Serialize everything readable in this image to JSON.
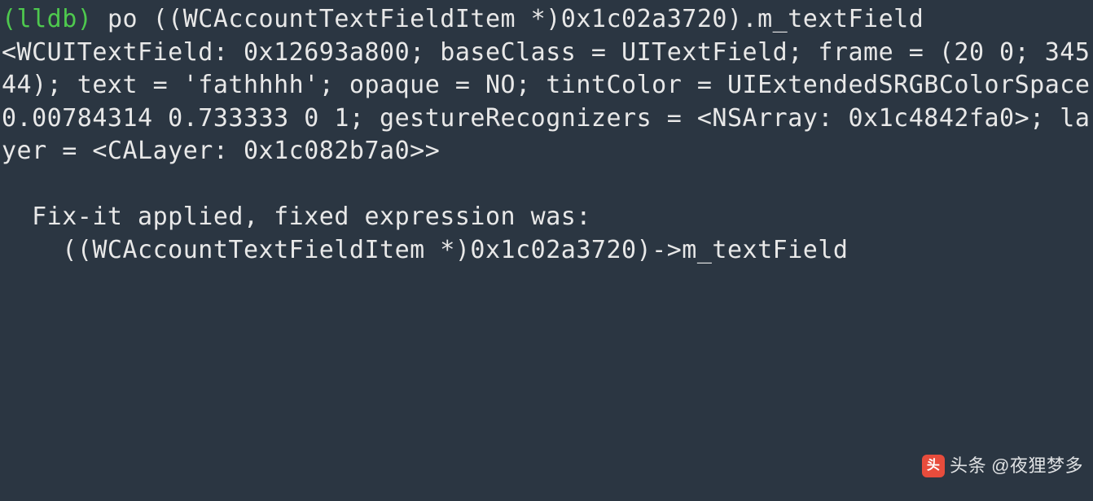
{
  "terminal": {
    "prompt": "(lldb) ",
    "command": "po ((WCAccountTextFieldItem *)0x1c02a3720).m_textField",
    "output_lines": [
      "<WCUITextField: 0x12693a800; baseClass = UITextField; frame = (20 0; 345 44); text = 'fathhhh'; opaque = NO; tintColor = UIExtendedSRGBColorSpace 0.00784314 0.733333 0 1; gestureRecognizers = <NSArray: 0x1c4842fa0>; layer = <CALayer: 0x1c082b7a0>>",
      "",
      "  Fix-it applied, fixed expression was:",
      "    ((WCAccountTextFieldItem *)0x1c02a3720)->m_textField"
    ]
  },
  "watermark": {
    "brand_char": "头",
    "label": "头条",
    "user": "@夜狸梦多"
  }
}
